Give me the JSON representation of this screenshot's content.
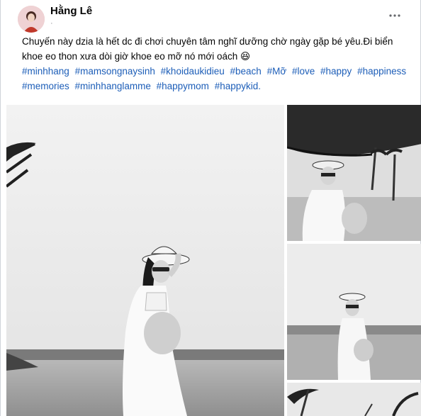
{
  "post": {
    "author": "Hằng Lê",
    "time": "· ",
    "text": "Chuyến này dzia là hết dc đi chơi chuyên tâm nghĩ dưỡng chờ ngày gặp bé yêu.Đi biển khoe eo thon xưa dòi giờ khoe eo mỡ nó mới oách 😆",
    "hashtags": [
      "#minhhang",
      "#mamsongnaysinh",
      "#khoidaukidieu",
      "#beach",
      "#Mỡ",
      "#love",
      "#happy",
      "#happiness",
      "#memories",
      "#minhhanglamme",
      "#happymom",
      "#happykid."
    ],
    "more_icon": "more-horizontal-icon"
  },
  "colors": {
    "hashtag": "#1d5eb8",
    "text": "#050505",
    "meta": "#8a8d91"
  }
}
